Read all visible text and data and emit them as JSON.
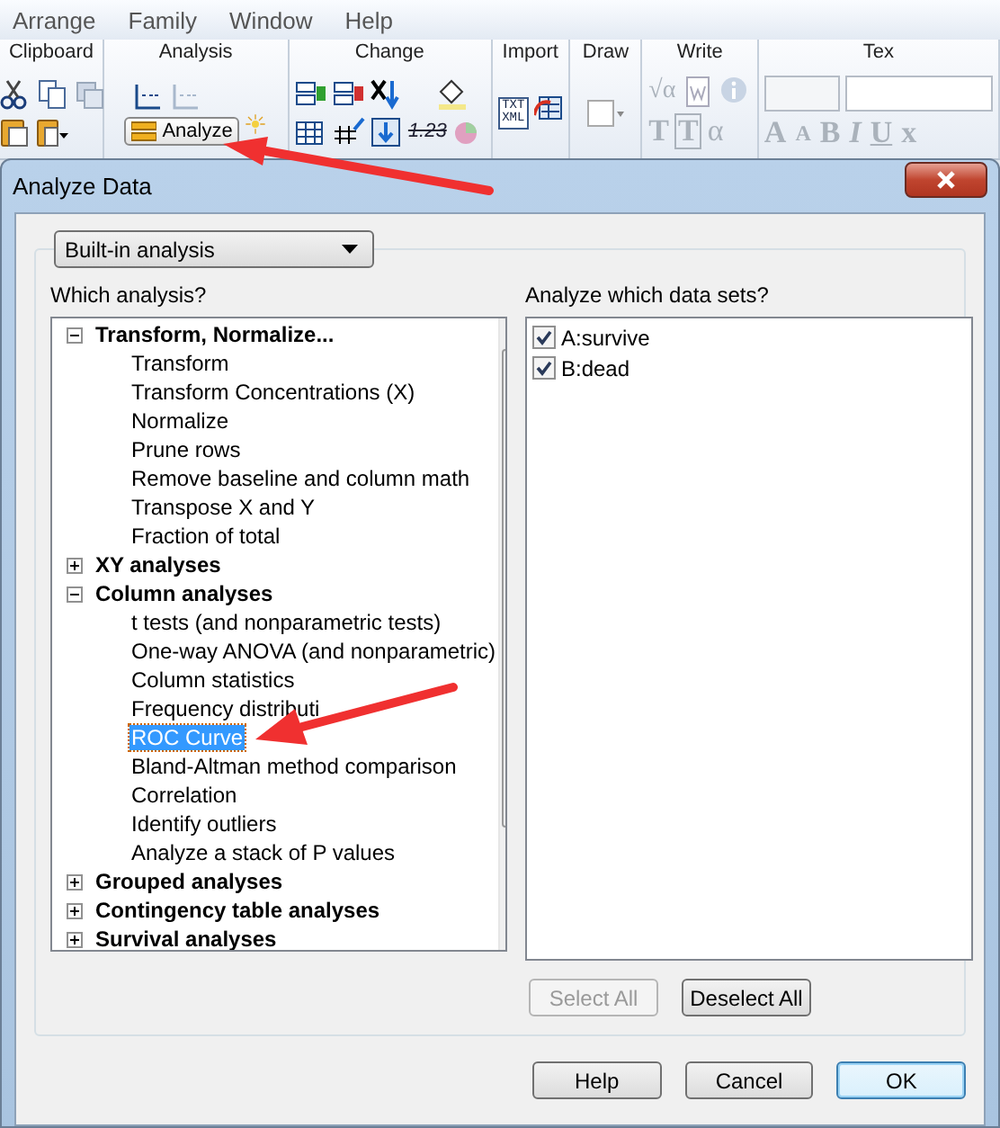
{
  "menu_bar": [
    "Arrange",
    "Family",
    "Window",
    "Help"
  ],
  "ribbon": {
    "groups": [
      {
        "label": "Clipboard",
        "kind": "clipboard"
      },
      {
        "label": "Analysis",
        "kind": "analysis",
        "button": "Analyze"
      },
      {
        "label": "Change",
        "kind": "change",
        "number_glyph": "1.23"
      },
      {
        "label": "Import",
        "kind": "import",
        "icon_text": [
          "TXT",
          "XML"
        ]
      },
      {
        "label": "Draw",
        "kind": "draw"
      },
      {
        "label": "Write",
        "kind": "write",
        "glyphs": [
          "√α",
          "T",
          "T",
          "α"
        ]
      },
      {
        "label": "Tex",
        "kind": "text",
        "glyphs": [
          "A",
          "A",
          "B",
          "I",
          "U",
          "x"
        ]
      }
    ]
  },
  "dialog": {
    "title": "Analyze Data",
    "analysis_type": "Built-in analysis",
    "tree_label": "Which analysis?",
    "tree": [
      {
        "label": "Transform, Normalize...",
        "expanded": true,
        "selected": false,
        "children": [
          {
            "label": "Transform",
            "selected": false
          },
          {
            "label": "Transform Concentrations (X)",
            "selected": false
          },
          {
            "label": "Normalize",
            "selected": false
          },
          {
            "label": "Prune rows",
            "selected": false
          },
          {
            "label": "Remove baseline and column math",
            "selected": false
          },
          {
            "label": "Transpose X and Y",
            "selected": false
          },
          {
            "label": "Fraction of total",
            "selected": false
          }
        ]
      },
      {
        "label": "XY analyses",
        "expanded": false,
        "selected": false
      },
      {
        "label": "Column analyses",
        "expanded": true,
        "selected": false,
        "children": [
          {
            "label": "t tests (and nonparametric tests)",
            "selected": false
          },
          {
            "label": "One-way ANOVA (and nonparametric)",
            "selected": false
          },
          {
            "label": "Column statistics",
            "selected": false
          },
          {
            "label": "Frequency distributi",
            "selected": false
          },
          {
            "label": "ROC Curve",
            "selected": true
          },
          {
            "label": "Bland-Altman method comparison",
            "selected": false
          },
          {
            "label": "Correlation",
            "selected": false
          },
          {
            "label": "Identify outliers",
            "selected": false
          },
          {
            "label": "Analyze a stack of P values",
            "selected": false
          }
        ]
      },
      {
        "label": "Grouped analyses",
        "expanded": false,
        "selected": false
      },
      {
        "label": "Contingency table analyses",
        "expanded": false,
        "selected": false
      },
      {
        "label": "Survival analyses",
        "expanded": false,
        "selected": false
      }
    ],
    "datasets_label": "Analyze which data sets?",
    "datasets": [
      {
        "label": "A:survive",
        "checked": true
      },
      {
        "label": "B:dead",
        "checked": true
      }
    ],
    "select_all": {
      "label": "Select All",
      "disabled": true
    },
    "deselect_all": {
      "label": "Deselect All",
      "disabled": false
    },
    "buttons": [
      {
        "label": "Help",
        "default": false
      },
      {
        "label": "Cancel",
        "default": false
      },
      {
        "label": "OK",
        "default": true
      }
    ]
  }
}
